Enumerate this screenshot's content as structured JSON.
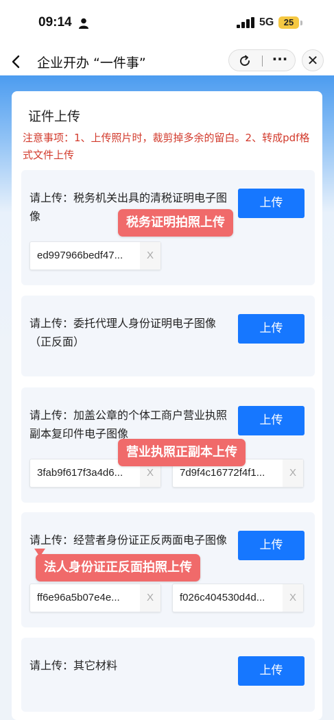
{
  "status_bar": {
    "time": "09:14",
    "network": "5G",
    "battery": "25"
  },
  "nav": {
    "title": "企业开办 “一件事”"
  },
  "card": {
    "title": "证件上传",
    "notice": "注意事项：1、上传照片时，裁剪掉多余的留白。2、转成pdf格式文件上传"
  },
  "items": [
    {
      "label": "请上传：税务机关出具的清税证明电子图像",
      "button": "上传",
      "files": [
        "ed997966bedf47..."
      ]
    },
    {
      "label": "请上传：委托代理人身份证明电子图像（正反面）",
      "button": "上传",
      "files": []
    },
    {
      "label": "请上传：加盖公章的个体工商户营业执照副本复印件电子图像",
      "button": "上传",
      "files": [
        "3fab9f617f3a4d6...",
        "7d9f4c16772f4f1..."
      ]
    },
    {
      "label": "请上传：经营者身份证正反两面电子图像",
      "button": "上传",
      "files": [
        "ff6e96a5b07e4e...",
        "f026c404530d4d..."
      ]
    },
    {
      "label": "请上传：其它材料",
      "button": "上传",
      "files": []
    }
  ],
  "file_remove_symbol": "X",
  "annotations": [
    {
      "text": "税务证明拍照上传"
    },
    {
      "text": "营业执照正副本上传"
    },
    {
      "text": "法人身份证正反面拍照上传"
    }
  ],
  "colors": {
    "primary": "#1677ff",
    "notice": "#d23a2c",
    "annotation": "#f06a6a",
    "battery": "#f5c842"
  }
}
